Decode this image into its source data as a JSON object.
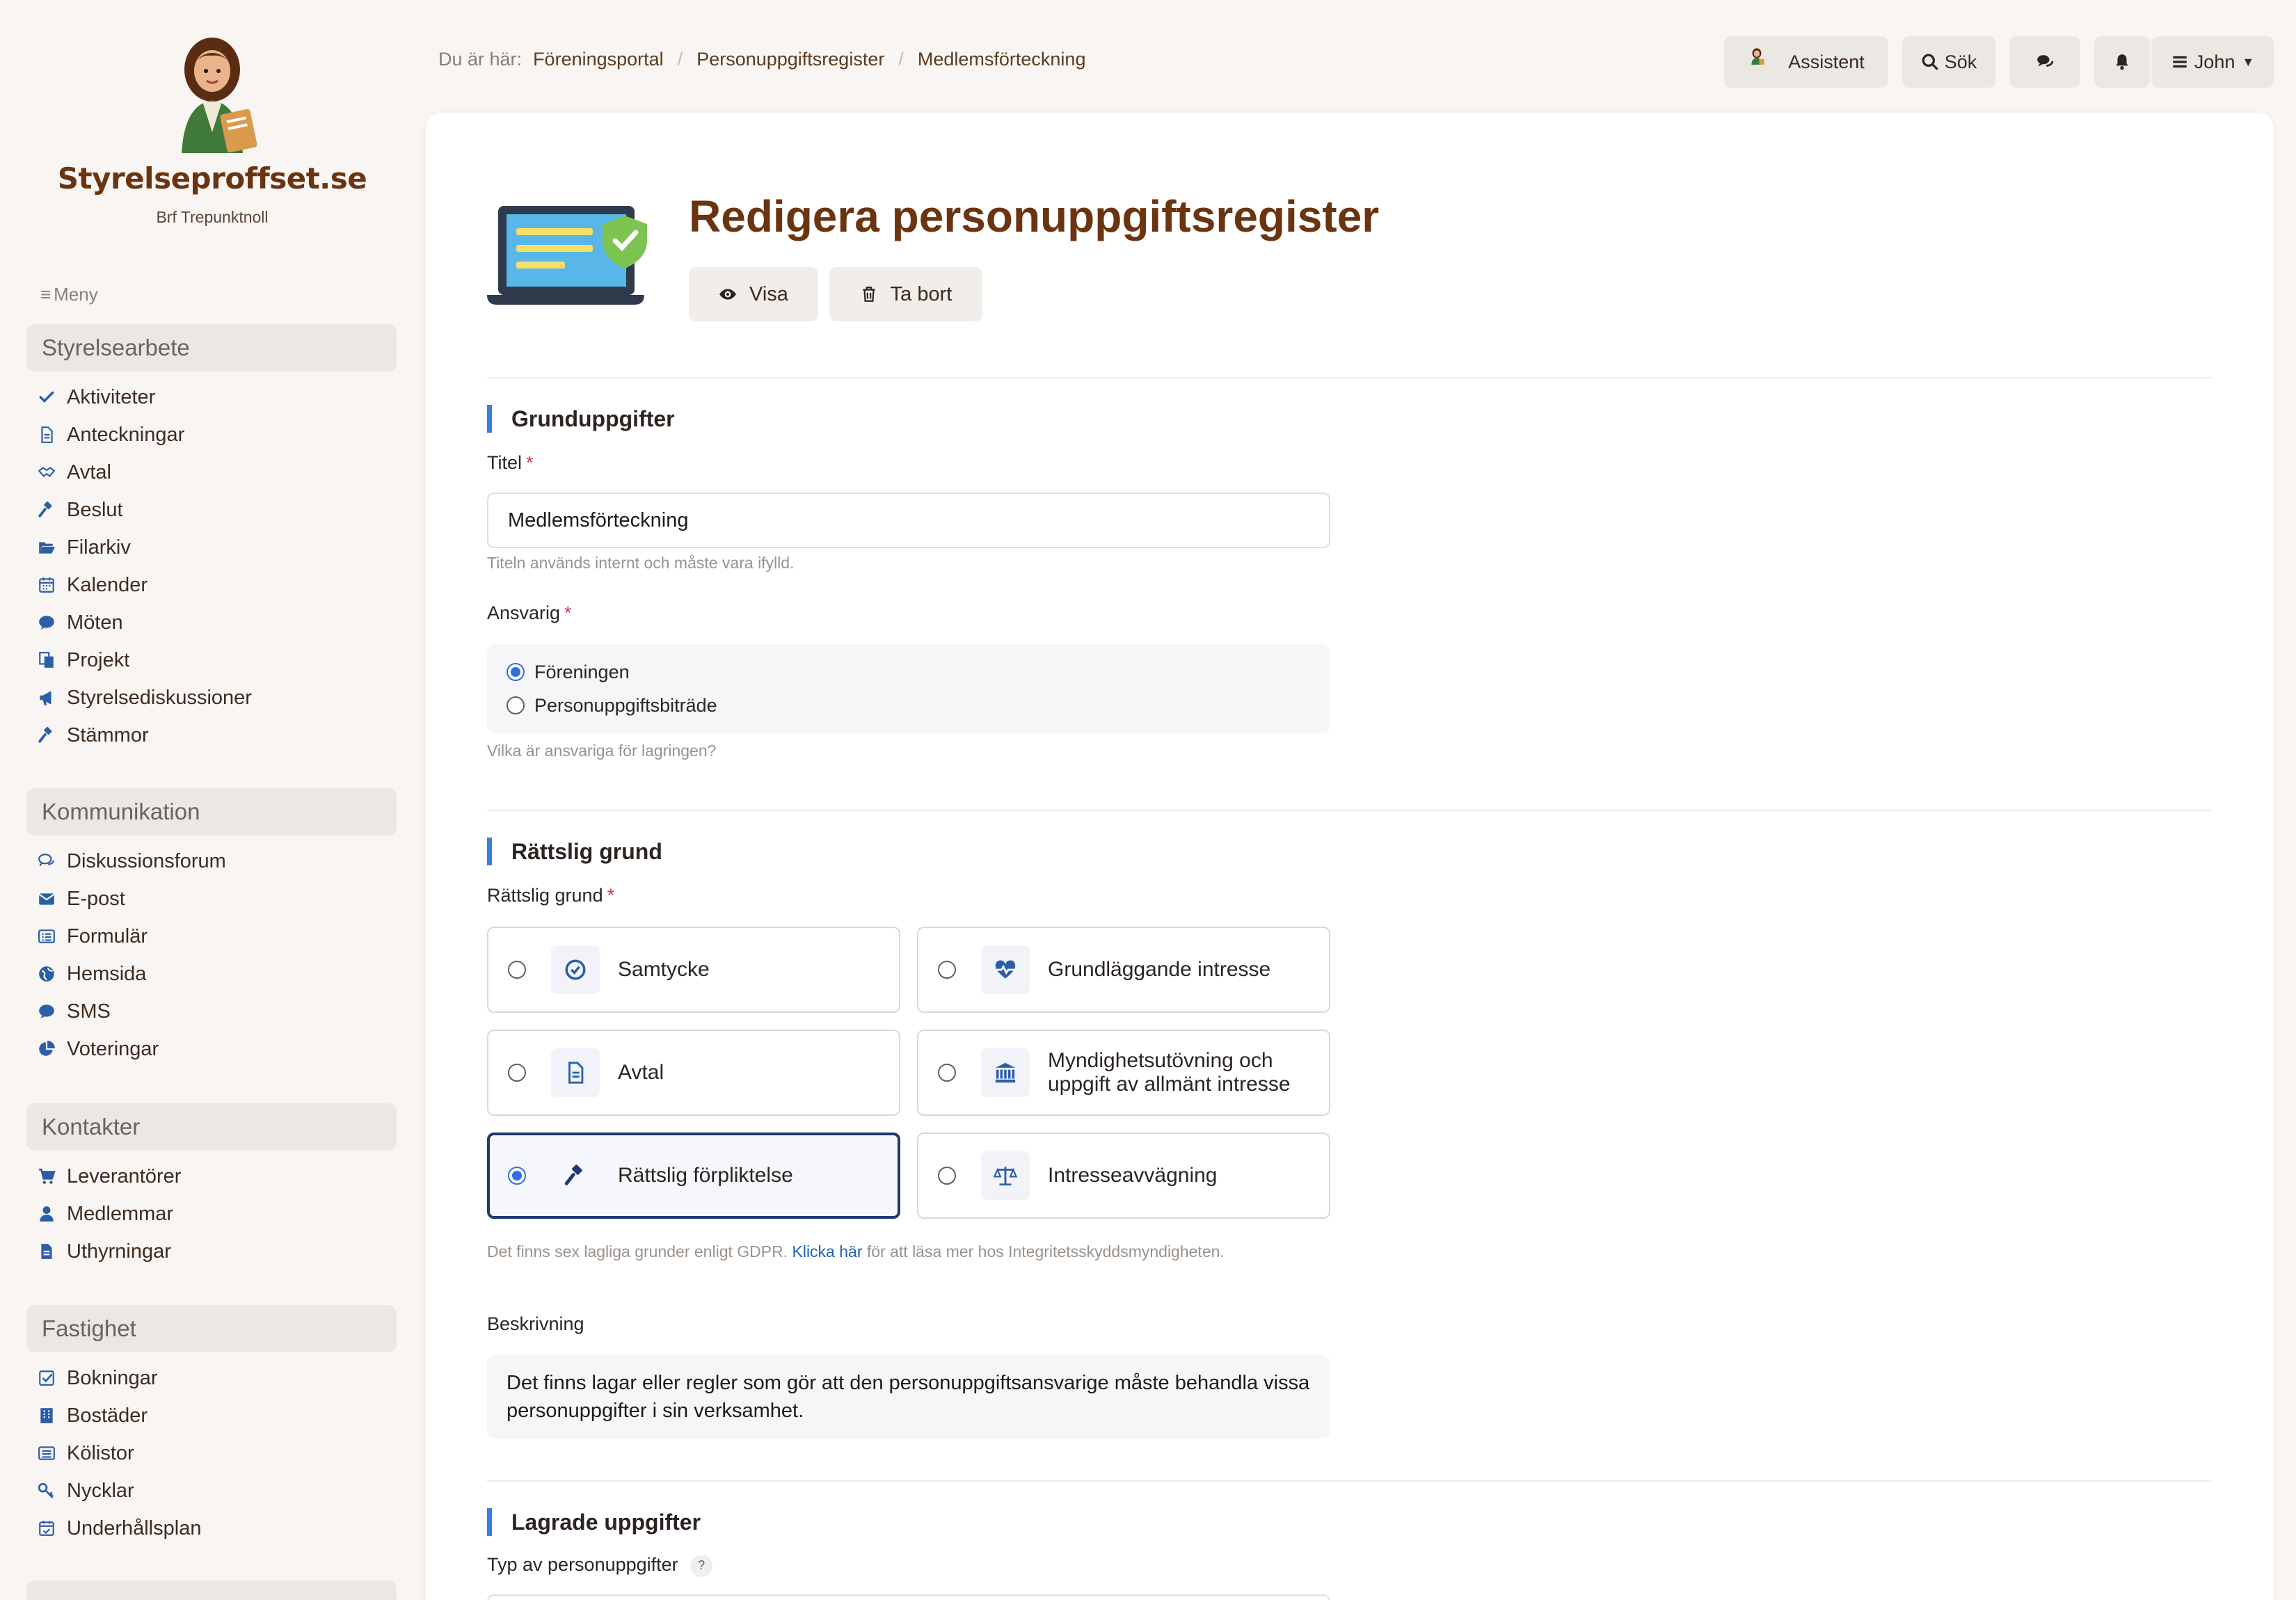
{
  "brand": {
    "name": "Styrelseproffset.se",
    "org": "Brf Trepunktnoll"
  },
  "menu_label": "Meny",
  "sidebar": {
    "sections": [
      {
        "title": "Styrelsearbete",
        "items": [
          {
            "label": "Aktiviteter",
            "icon": "check-icon"
          },
          {
            "label": "Anteckningar",
            "icon": "file-icon"
          },
          {
            "label": "Avtal",
            "icon": "handshake-icon"
          },
          {
            "label": "Beslut",
            "icon": "gavel-icon"
          },
          {
            "label": "Filarkiv",
            "icon": "folder-open-icon"
          },
          {
            "label": "Kalender",
            "icon": "calendar-icon"
          },
          {
            "label": "Möten",
            "icon": "comment-icon"
          },
          {
            "label": "Projekt",
            "icon": "copy-icon"
          },
          {
            "label": "Styrelsediskussioner",
            "icon": "bullhorn-icon"
          },
          {
            "label": "Stämmor",
            "icon": "gavel-icon"
          }
        ]
      },
      {
        "title": "Kommunikation",
        "items": [
          {
            "label": "Diskussionsforum",
            "icon": "comments-icon"
          },
          {
            "label": "E-post",
            "icon": "envelope-icon"
          },
          {
            "label": "Formulär",
            "icon": "list-alt-icon"
          },
          {
            "label": "Hemsida",
            "icon": "globe-icon"
          },
          {
            "label": "SMS",
            "icon": "comment-icon"
          },
          {
            "label": "Voteringar",
            "icon": "pie-chart-icon"
          }
        ]
      },
      {
        "title": "Kontakter",
        "items": [
          {
            "label": "Leverantörer",
            "icon": "cart-icon"
          },
          {
            "label": "Medlemmar",
            "icon": "user-icon"
          },
          {
            "label": "Uthyrningar",
            "icon": "file-text-icon"
          }
        ]
      },
      {
        "title": "Fastighet",
        "items": [
          {
            "label": "Bokningar",
            "icon": "check-square-icon"
          },
          {
            "label": "Bostäder",
            "icon": "building-icon"
          },
          {
            "label": "Kölistor",
            "icon": "list-icon"
          },
          {
            "label": "Nycklar",
            "icon": "key-icon"
          },
          {
            "label": "Underhållsplan",
            "icon": "calendar-check-icon"
          }
        ]
      }
    ]
  },
  "breadcrumb": {
    "prefix": "Du är här:",
    "items": [
      "Föreningsportal",
      "Personuppgiftsregister",
      "Medlemsförteckning"
    ]
  },
  "topbar": {
    "assistant": "Assistent",
    "search": "Sök",
    "user": "John"
  },
  "page": {
    "title": "Redigera personuppgiftsregister",
    "view_button": "Visa",
    "delete_button": "Ta bort"
  },
  "form": {
    "basic": {
      "heading": "Grunduppgifter",
      "title_label": "Titel",
      "title_value": "Medlemsförteckning",
      "title_help": "Titeln används internt och måste vara ifylld.",
      "responsible_label": "Ansvarig",
      "responsible_options": [
        "Föreningen",
        "Personuppgiftsbiträde"
      ],
      "responsible_selected": "Föreningen",
      "responsible_help": "Vilka är ansvariga för lagringen?"
    },
    "legal": {
      "heading": "Rättslig grund",
      "label": "Rättslig grund",
      "options": [
        {
          "label": "Samtycke",
          "icon": "check-circle-icon"
        },
        {
          "label": "Grundläggande intresse",
          "icon": "heartbeat-icon"
        },
        {
          "label": "Avtal",
          "icon": "file-icon"
        },
        {
          "label": "Myndighetsutövning och uppgift av allmänt intresse",
          "icon": "bank-icon"
        },
        {
          "label": "Rättslig förpliktelse",
          "icon": "gavel-icon"
        },
        {
          "label": "Intresseavvägning",
          "icon": "balance-scale-icon"
        }
      ],
      "selected": "Rättslig förpliktelse",
      "help_before": "Det finns sex lagliga grunder enligt GDPR.",
      "help_link": "Klicka här",
      "help_after": "för att läsa mer hos Integritetsskyddsmyndigheten.",
      "description_label": "Beskrivning",
      "description": "Det finns lagar eller regler som gör att den personuppgiftsansvarige måste behandla vissa personuppgifter i sin verksamhet."
    },
    "stored": {
      "heading": "Lagrade uppgifter",
      "type_label": "Typ av personuppgifter",
      "type_hint": "?"
    }
  },
  "colors": {
    "accent": "#3b7de0",
    "brand": "#6b3410",
    "selected_border": "#1e3a6e"
  }
}
